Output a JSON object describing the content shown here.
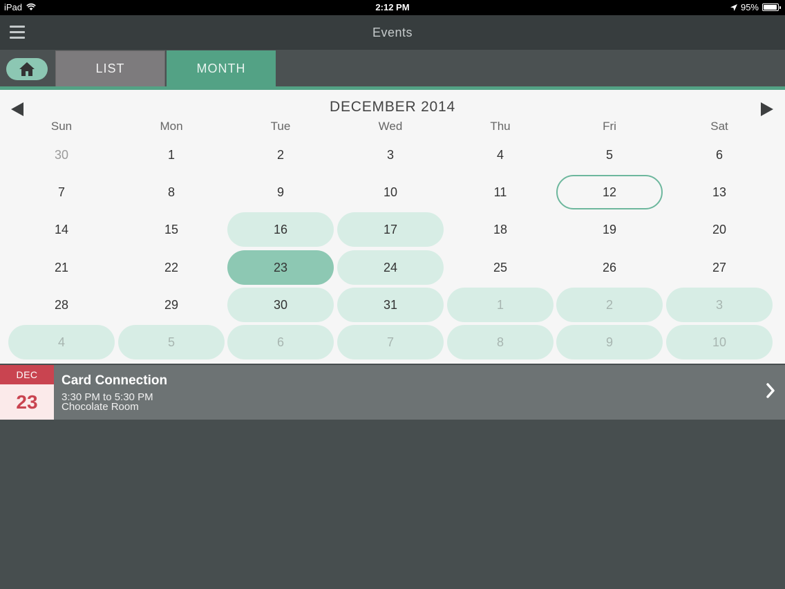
{
  "status_bar": {
    "carrier": "iPad",
    "time": "2:12 PM",
    "battery": "95%",
    "battery_level": 0.95
  },
  "nav": {
    "title": "Events"
  },
  "tabs": {
    "list": "LIST",
    "month": "MONTH",
    "active": "MONTH"
  },
  "calendar": {
    "title": "DECEMBER 2014",
    "weekdays": [
      "Sun",
      "Mon",
      "Tue",
      "Wed",
      "Thu",
      "Fri",
      "Sat"
    ],
    "weeks": [
      [
        {
          "d": "30",
          "o": true
        },
        {
          "d": "1"
        },
        {
          "d": "2"
        },
        {
          "d": "3"
        },
        {
          "d": "4"
        },
        {
          "d": "5"
        },
        {
          "d": "6"
        }
      ],
      [
        {
          "d": "7"
        },
        {
          "d": "8"
        },
        {
          "d": "9"
        },
        {
          "d": "10"
        },
        {
          "d": "11"
        },
        {
          "d": "12",
          "today": true
        },
        {
          "d": "13"
        }
      ],
      [
        {
          "d": "14"
        },
        {
          "d": "15"
        },
        {
          "d": "16",
          "e": true
        },
        {
          "d": "17",
          "e": true
        },
        {
          "d": "18"
        },
        {
          "d": "19"
        },
        {
          "d": "20"
        }
      ],
      [
        {
          "d": "21"
        },
        {
          "d": "22"
        },
        {
          "d": "23",
          "e": true,
          "sel": true
        },
        {
          "d": "24",
          "e": true
        },
        {
          "d": "25"
        },
        {
          "d": "26"
        },
        {
          "d": "27"
        }
      ],
      [
        {
          "d": "28"
        },
        {
          "d": "29"
        },
        {
          "d": "30",
          "e": true
        },
        {
          "d": "31",
          "e": true
        },
        {
          "d": "1",
          "o": true,
          "e": true
        },
        {
          "d": "2",
          "o": true,
          "e": true
        },
        {
          "d": "3",
          "o": true,
          "e": true
        }
      ],
      [
        {
          "d": "4",
          "o": true,
          "e": true
        },
        {
          "d": "5",
          "o": true,
          "e": true
        },
        {
          "d": "6",
          "o": true,
          "e": true
        },
        {
          "d": "7",
          "o": true,
          "e": true
        },
        {
          "d": "8",
          "o": true,
          "e": true
        },
        {
          "d": "9",
          "o": true,
          "e": true
        },
        {
          "d": "10",
          "o": true,
          "e": true
        }
      ]
    ]
  },
  "event": {
    "month": "DEC",
    "day": "23",
    "title": "Card Connection",
    "time": "3:30 PM to 5:30 PM",
    "location": "Chocolate Room"
  },
  "colors": {
    "accent": "#53a285",
    "event_day": "#d7ede5",
    "selected_day": "#8dc8b3",
    "date_badge": "#c94450"
  },
  "icons": {
    "menu": "hamburger-icon",
    "home": "home-icon",
    "prev": "triangle-left-icon",
    "next": "triangle-right-icon",
    "chevron": "chevron-right-icon"
  }
}
